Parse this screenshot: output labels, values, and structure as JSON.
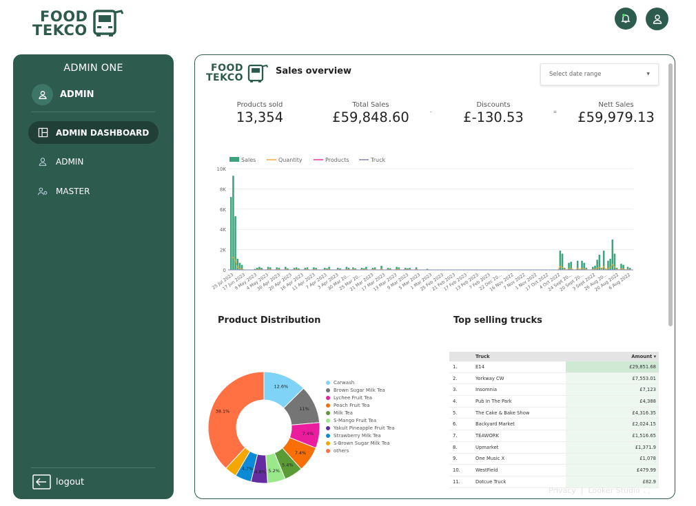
{
  "brand": {
    "line1": "FOOD",
    "line2": "TEKCO"
  },
  "header": {
    "notification_icon": "bell-icon",
    "profile_icon": "user-icon"
  },
  "sidebar": {
    "title": "ADMIN ONE",
    "role": "ADMIN",
    "items": [
      {
        "label": "ADMIN DASHBOARD",
        "icon": "dashboard-icon",
        "active": true
      },
      {
        "label": "ADMIN",
        "icon": "user-icon"
      },
      {
        "label": "MASTER",
        "icon": "people-gear-icon"
      }
    ],
    "logout_label": "logout"
  },
  "report": {
    "title": "Sales overview",
    "date_placeholder": "Select date range",
    "kpis": [
      {
        "label": "Products sold",
        "value": "13,354"
      },
      {
        "label": "Total Sales",
        "value": "£59,848.60"
      },
      {
        "label": "Discounts",
        "value": "£-130.53"
      },
      {
        "label": "Nett Sales",
        "value": "£59,979.13"
      }
    ],
    "ops": [
      "-",
      "="
    ],
    "distribution_title": "Product Distribution",
    "trucks_title": "Top selling trucks",
    "footer": {
      "privacy": "Privacy",
      "looker": "Looker Studio"
    }
  },
  "colors": {
    "primary": "#2d5b4e",
    "sales": "#3aa57a",
    "quantity": "#f4a63a",
    "products": "#e8358f",
    "truck": "#7b85b8"
  },
  "chart_data": [
    {
      "type": "bar",
      "legend": [
        "Sales",
        "Quantity",
        "Products",
        "Truck"
      ],
      "ylim": [
        0,
        10000
      ],
      "yticks": [
        "10K",
        "8K",
        "6K",
        "4K",
        "2K",
        "0"
      ],
      "x_ticks": [
        "25 Jul 2023",
        "17 Jun 2023",
        "9 May 2023",
        "4 May 2023",
        "30 Apr 2023",
        "20 Apr 2023",
        "16 Apr 2023",
        "11 Apr 2023",
        "7 Apr 2023",
        "3 Apr 2023",
        "30 Mar 20...",
        "25 Mar 20...",
        "21 Mar 2023",
        "17 Mar 2023",
        "13 Mar 2023",
        "9 Mar 2023",
        "5 Mar 2023",
        "1 Mar 2023",
        "25 Feb 2023",
        "21 Feb 2023",
        "17 Feb 2023",
        "13 Feb 2023",
        "7 Feb 2023",
        "22 Dec 20...",
        "16 Nov 2022",
        "7 Nov 2022",
        "1 Nov 2022",
        "17 Oct 2022",
        "4 Oct 2022",
        "24 Sept 20...",
        "20 Sept 20...",
        "3 Sept 2022",
        "26 Aug 20...",
        "20 Aug 2022",
        "6 Aug 2022"
      ],
      "sales": [
        7200,
        9300,
        5300,
        1100,
        700,
        500,
        0,
        0,
        0,
        0,
        0,
        100,
        200,
        300,
        200,
        0,
        0,
        300,
        250,
        0,
        0,
        250,
        200,
        0,
        0,
        300,
        150,
        0,
        0,
        200,
        250,
        150,
        0,
        0,
        200,
        250,
        0,
        0,
        250,
        200,
        0,
        0,
        0,
        200,
        150,
        300,
        0,
        0,
        0,
        200,
        150,
        0,
        0,
        300,
        200,
        0,
        250,
        150,
        0,
        0,
        200,
        150,
        300,
        0,
        0,
        200,
        250,
        0,
        0,
        400,
        0,
        0,
        200,
        150,
        0,
        0,
        300,
        250,
        0,
        0,
        200,
        150,
        200,
        0,
        0,
        250,
        0,
        0,
        0,
        0,
        100,
        0,
        0,
        0,
        0,
        0,
        0,
        0,
        0,
        0,
        0,
        0,
        0,
        0,
        0,
        0,
        0,
        0,
        0,
        0,
        0,
        0,
        0,
        0,
        0,
        0,
        0,
        0,
        0,
        0,
        0,
        0,
        0,
        0,
        0,
        0,
        0,
        0,
        0,
        0,
        0,
        0,
        0,
        0,
        0,
        0,
        0,
        0,
        0,
        0,
        0,
        0,
        0,
        0,
        0,
        0,
        0,
        0,
        0,
        0,
        0,
        1900,
        1600,
        200,
        0,
        700,
        800,
        0,
        0,
        900,
        100,
        900,
        700,
        200,
        0,
        0,
        300,
        400,
        1000,
        1500,
        200,
        1900,
        100,
        900,
        1100,
        3000,
        1600,
        200,
        0,
        600,
        500,
        0,
        300,
        200
      ]
    },
    {
      "type": "pie",
      "categories": [
        "Carwash",
        "Brown Sugar Milk Tea",
        "Lychee Fruit Tea",
        "Peach Fruit Tea",
        "Milk Tea",
        "S-Mango Fruit Tea",
        "Yakult Pineapple Fruit Tea",
        "Strawberry Milk Tea",
        "S-Brown Sugar Milk Tea",
        "others"
      ],
      "values": [
        12.6,
        11,
        7.4,
        7.4,
        5.4,
        5.2,
        4.8,
        4.7,
        3.5,
        38.1
      ],
      "labels": [
        "12.6%",
        "11%",
        "7.4%",
        "7.4%",
        "5.4%",
        "5.2%",
        "4.8%",
        "4.7%",
        "",
        "38.1%"
      ],
      "colors": [
        "#7fd3f7",
        "#757575",
        "#ec1c9f",
        "#f76f06",
        "#5a9b36",
        "#99e98b",
        "#652ba1",
        "#0c8ad6",
        "#f5a700",
        "#ff7043"
      ]
    },
    {
      "type": "table",
      "columns": [
        "Truck",
        "Amount ▾"
      ],
      "rows": [
        [
          "1.",
          "E14",
          "£29,851.68"
        ],
        [
          "2.",
          "Yorkway CW",
          "£7,553.01"
        ],
        [
          "3.",
          "Insomnia",
          "£7,123"
        ],
        [
          "4.",
          "Pub In The Park",
          "£4,388"
        ],
        [
          "5.",
          "The Cake & Bake Show",
          "£4,316.35"
        ],
        [
          "6.",
          "Backyard Market",
          "£2,024.15"
        ],
        [
          "7.",
          "TEAWORK",
          "£1,516.65"
        ],
        [
          "8.",
          "Upmarket",
          "£1,371.9"
        ],
        [
          "9.",
          "One Music X",
          "£1,078"
        ],
        [
          "10.",
          "WestField",
          "£479.99"
        ],
        [
          "11.",
          "Dotcue Truck",
          "£82.9"
        ]
      ]
    }
  ]
}
